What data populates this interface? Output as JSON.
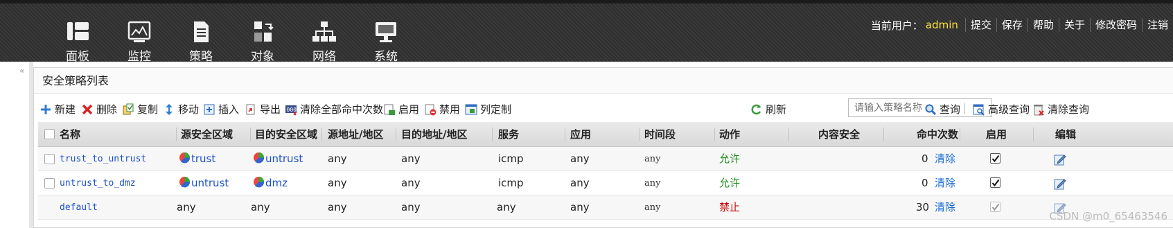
{
  "nav": {
    "items": [
      {
        "label": "面板",
        "icon": "panel-icon"
      },
      {
        "label": "监控",
        "icon": "monitor-icon"
      },
      {
        "label": "策略",
        "icon": "policy-icon"
      },
      {
        "label": "对象",
        "icon": "object-icon"
      },
      {
        "label": "网络",
        "icon": "network-icon"
      },
      {
        "label": "系统",
        "icon": "system-icon"
      }
    ],
    "user_label": "当前用户：",
    "user_name": "admin",
    "links": [
      "提交",
      "保存",
      "帮助",
      "关于",
      "修改密码",
      "注销"
    ]
  },
  "panel": {
    "title": "安全策略列表"
  },
  "toolbar": {
    "new": "新建",
    "delete": "删除",
    "copy": "复制",
    "move": "移动",
    "insert": "插入",
    "export": "导出",
    "clear_hits": "清除全部命中次数",
    "enable": "启用",
    "disable": "禁用",
    "columns": "列定制",
    "refresh": "刷新",
    "search_placeholder": "请输入策略名称",
    "query": "查询",
    "advanced_query": "高级查询",
    "clear_query": "清除查询"
  },
  "table": {
    "headers": {
      "name": "名称",
      "src_zone": "源安全区域",
      "dst_zone": "目的安全区域",
      "src_addr": "源地址/地区",
      "dst_addr": "目的地址/地区",
      "service": "服务",
      "app": "应用",
      "time": "时间段",
      "action": "动作",
      "content": "内容安全",
      "hits": "命中次数",
      "enabled": "启用",
      "edit": "编辑"
    },
    "rows": [
      {
        "name": "trust_to_untrust",
        "src_zone": "trust",
        "dst_zone": "untrust",
        "src_addr": "any",
        "dst_addr": "any",
        "service": "icmp",
        "app": "any",
        "time": "any",
        "action": "允许",
        "hits": "0",
        "clear": "清除",
        "enabled": true
      },
      {
        "name": "untrust_to_dmz",
        "src_zone": "untrust",
        "dst_zone": "dmz",
        "src_addr": "any",
        "dst_addr": "any",
        "service": "icmp",
        "app": "any",
        "time": "any",
        "action": "允许",
        "hits": "0",
        "clear": "清除",
        "enabled": true
      },
      {
        "name": "default",
        "src_zone": "any",
        "dst_zone": "any",
        "src_addr": "any",
        "dst_addr": "any",
        "service": "any",
        "app": "any",
        "time": "any",
        "action": "禁止",
        "hits": "30",
        "clear": "清除",
        "enabled": true
      }
    ]
  },
  "watermark": "CSDN @m0_65463546",
  "colors": {
    "allow": "#1e8e1e",
    "deny": "#cc0000",
    "link": "#1a6bd6",
    "user": "#ffe43a"
  }
}
